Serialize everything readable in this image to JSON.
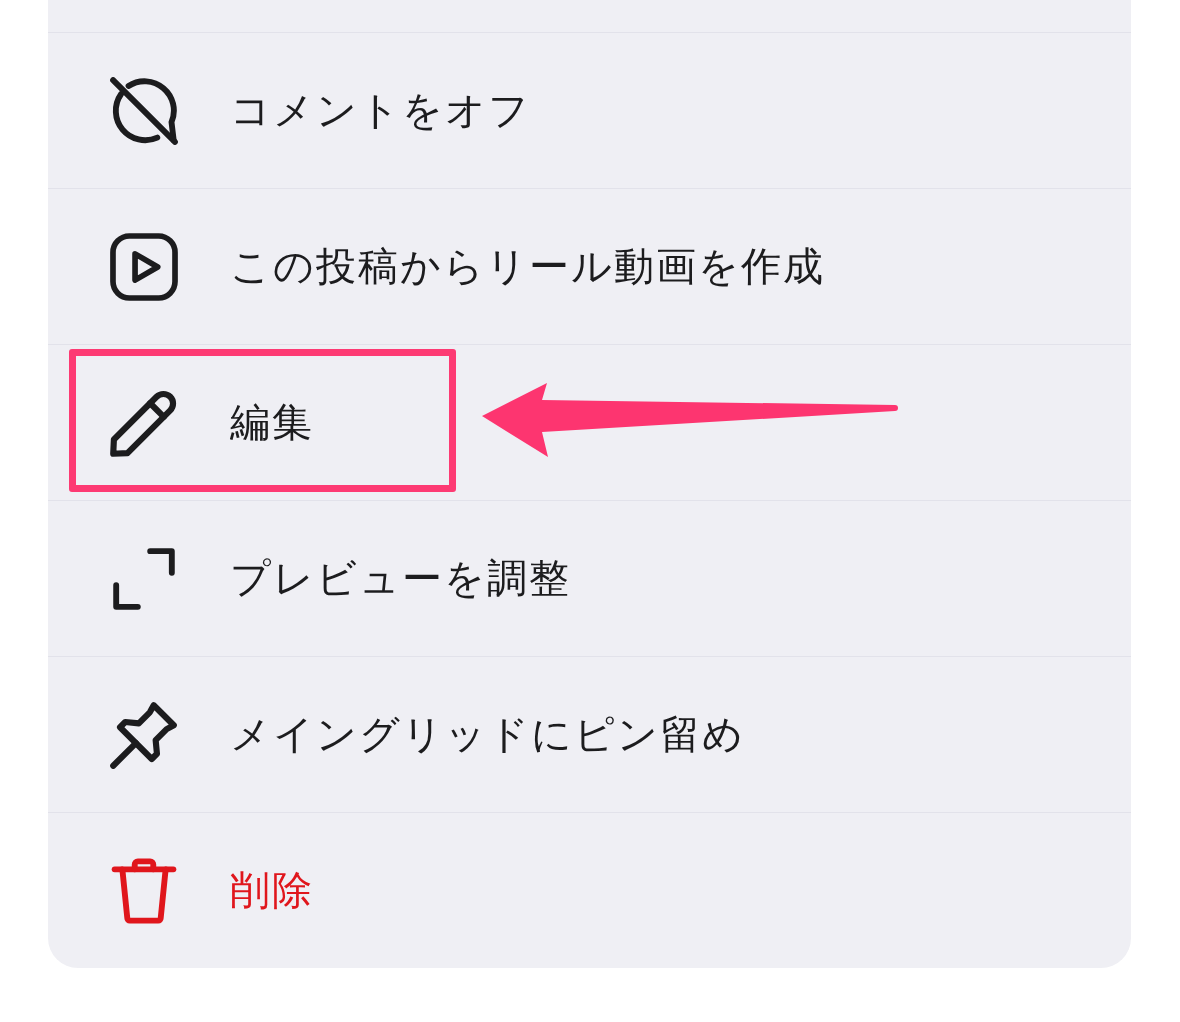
{
  "menu": {
    "items": [
      {
        "kind": "comment_off",
        "label": "コメントをオフ",
        "destructive": false,
        "highlighted": false
      },
      {
        "kind": "reel",
        "label": "この投稿からリール動画を作成",
        "destructive": false,
        "highlighted": false
      },
      {
        "kind": "edit",
        "label": "編集",
        "destructive": false,
        "highlighted": true
      },
      {
        "kind": "preview",
        "label": "プレビューを調整",
        "destructive": false,
        "highlighted": false
      },
      {
        "kind": "pin",
        "label": "メイングリッドにピン留め",
        "destructive": false,
        "highlighted": false
      },
      {
        "kind": "delete",
        "label": "削除",
        "destructive": true,
        "highlighted": false
      }
    ]
  }
}
